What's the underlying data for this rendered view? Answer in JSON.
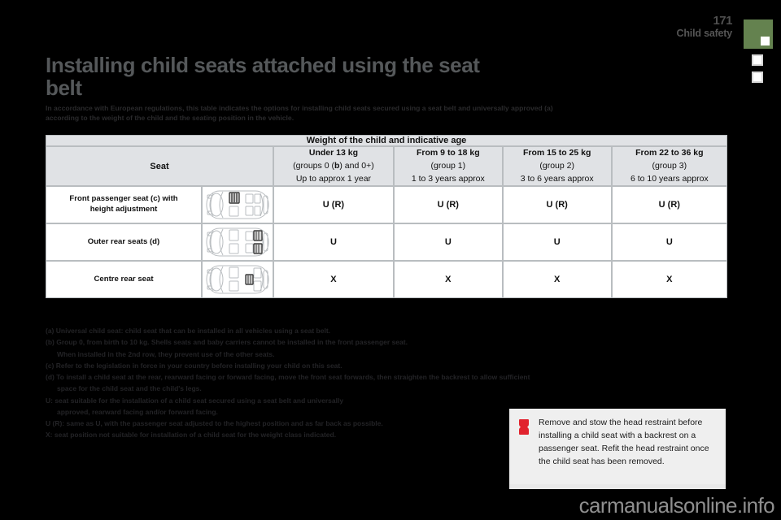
{
  "header": {
    "page_number": "171",
    "section": "Child safety",
    "tab_color": "#64824f"
  },
  "title": {
    "line1": "Installing child seats attached using the seat",
    "line2": "belt"
  },
  "intro": {
    "line1": "In accordance with European regulations, this table indicates the options for installing child seats secured using a seat belt and universally approved (a)",
    "line2": "according to the weight of the child and the seating position in the vehicle."
  },
  "table": {
    "top_header": "Weight of the child and indicative age",
    "seat_header": "Seat",
    "columns": [
      {
        "weight": "Under 13 kg",
        "group_pre": "(groups 0 (",
        "group_bold": "b",
        "group_post": ") and 0+)",
        "age": "Up to approx 1 year"
      },
      {
        "weight": "From 9 to 18 kg",
        "group": "(group 1)",
        "age": "1 to 3 years approx"
      },
      {
        "weight": "From 15 to 25 kg",
        "group": "(group 2)",
        "age": "3 to 6 years approx"
      },
      {
        "weight": "From 22 to 36 kg",
        "group": "(group 3)",
        "age": "6 to 10 years approx"
      }
    ],
    "rows": [
      {
        "label_line1": "Front passenger seat (c) with",
        "label_line2": "height adjustment",
        "icon": "car-top-view-front-passenger-highlighted",
        "values": [
          "U (R)",
          "U (R)",
          "U (R)",
          "U (R)"
        ]
      },
      {
        "label_line1": "Outer rear seats (d)",
        "label_line2": "",
        "icon": "car-top-view-outer-rear-highlighted",
        "values": [
          "U",
          "U",
          "U",
          "U"
        ]
      },
      {
        "label_line1": "Centre rear seat",
        "label_line2": "",
        "icon": "car-top-view-centre-rear-highlighted",
        "values": [
          "X",
          "X",
          "X",
          "X"
        ]
      }
    ]
  },
  "footnotes": [
    {
      "text": "(a) Universal child seat: child seat that can be installed in all vehicles using a seat belt.",
      "indent": false
    },
    {
      "text": "(b) Group 0, from birth to 10 kg. Shells seats and baby carriers cannot be installed in the front passenger seat.",
      "indent": false
    },
    {
      "text": "When installed in the 2nd row, they prevent use of the other seats.",
      "indent": true,
      "sup_after": "2",
      "sup_text": "nd"
    },
    {
      "text": "(c) Refer to the legislation in force in your country before installing your child on this seat.",
      "indent": false
    },
    {
      "text": "(d) To install a child seat at the rear, rearward facing or forward facing, move the front seat forwards, then straighten the backrest to allow sufficient",
      "indent": false
    },
    {
      "text": "space for the child seat and the child's legs.",
      "indent": true
    },
    {
      "text": "U: seat suitable for the installation of a child seat secured using a seat belt and universally",
      "indent": false
    },
    {
      "text": "approved, rearward facing and/or forward facing.",
      "indent": true
    },
    {
      "text": "U (R): same as U, with the passenger seat adjusted to the highest position and as far back as possible.",
      "indent": false
    },
    {
      "text": "X: seat position not suitable for installation of a child seat for the weight class indicated.",
      "indent": false
    }
  ],
  "warning": {
    "icon": "warning-exclamation-icon",
    "icon_color": "#e1232e",
    "text": "Remove and stow the head restraint before installing a child seat with a backrest on a passenger seat. Refit the head restraint once the child seat has been removed."
  },
  "watermark": "carmanualsonline.info"
}
